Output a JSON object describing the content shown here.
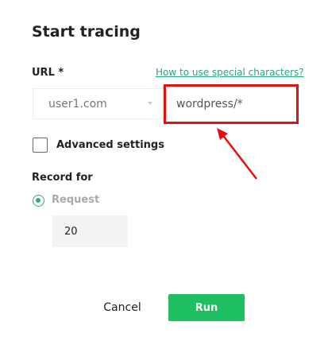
{
  "dialog": {
    "title": "Start tracing"
  },
  "url": {
    "label": "URL *",
    "help_link": "How to use special characters?",
    "domain_select": "user1.com",
    "path_value": "wordpress/*"
  },
  "advanced": {
    "label": "Advanced settings",
    "checked": false
  },
  "record": {
    "label": "Record for",
    "option": "Request",
    "selected": true,
    "count": "20"
  },
  "actions": {
    "cancel": "Cancel",
    "run": "Run"
  },
  "colors": {
    "accent": "#1dbf60",
    "highlight": "#e31010"
  }
}
